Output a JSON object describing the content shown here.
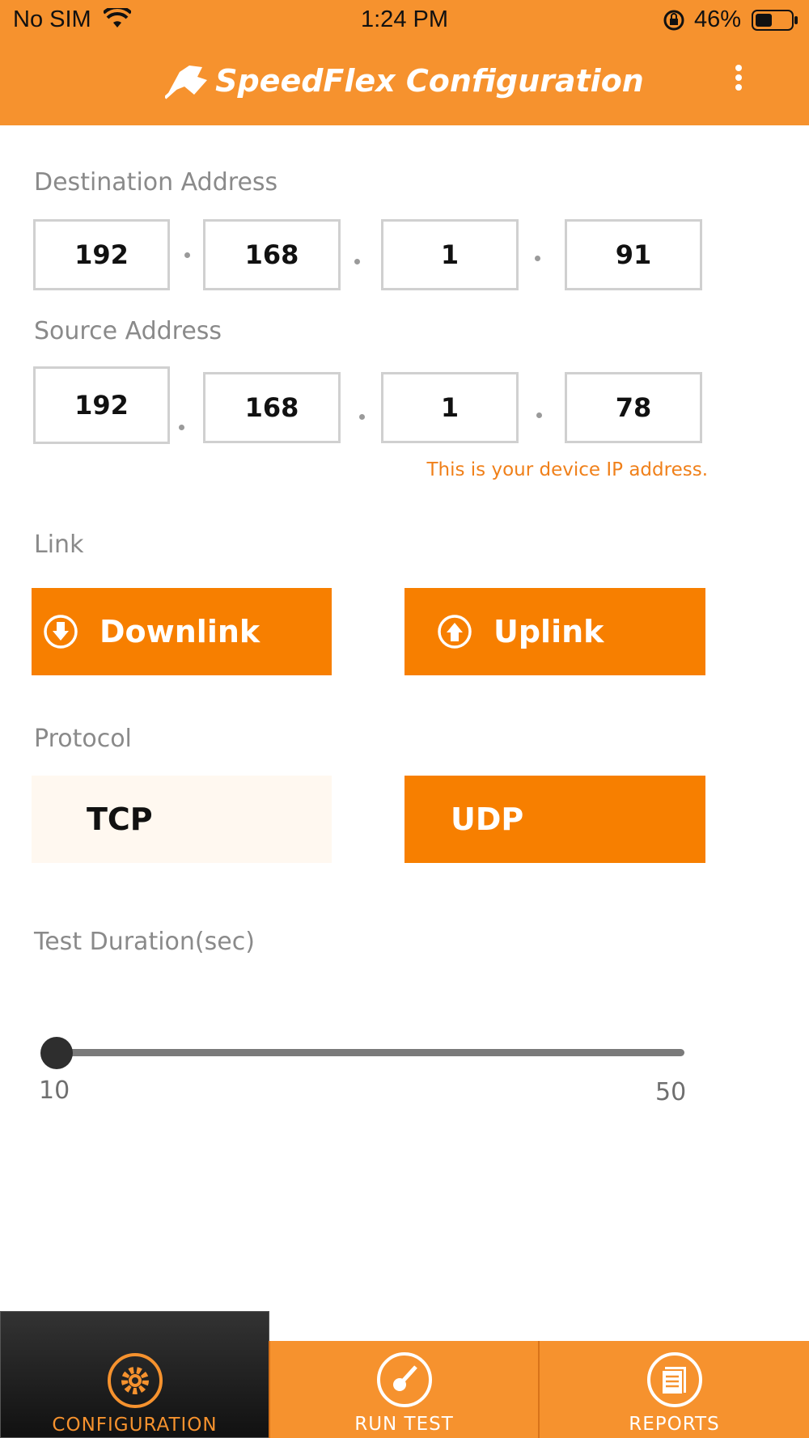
{
  "status_bar": {
    "carrier": "No SIM",
    "time": "1:24 PM",
    "battery": "46%"
  },
  "header": {
    "title": "SpeedFlex Configuration"
  },
  "destination": {
    "label": "Destination Address",
    "octets": [
      "192",
      "168",
      "1",
      "91"
    ]
  },
  "source": {
    "label": "Source Address",
    "octets": [
      "192",
      "168",
      "1",
      "78"
    ],
    "note": "This is your device IP address."
  },
  "link": {
    "label": "Link",
    "options": [
      "Downlink",
      "Uplink"
    ],
    "selected": [
      "Downlink",
      "Uplink"
    ]
  },
  "protocol": {
    "label": "Protocol",
    "options": [
      "TCP",
      "UDP"
    ],
    "selected": "UDP"
  },
  "duration": {
    "label": "Test Duration(sec)",
    "min": "10",
    "max": "50",
    "value": 10
  },
  "tabs": [
    {
      "label": "CONFIGURATION",
      "icon": "gear-icon",
      "active": true
    },
    {
      "label": "RUN TEST",
      "icon": "gauge-icon",
      "active": false
    },
    {
      "label": "REPORTS",
      "icon": "document-icon",
      "active": false
    }
  ],
  "colors": {
    "accent": "#f77f00",
    "bar": "#f6922e",
    "note": "#f0801a"
  }
}
